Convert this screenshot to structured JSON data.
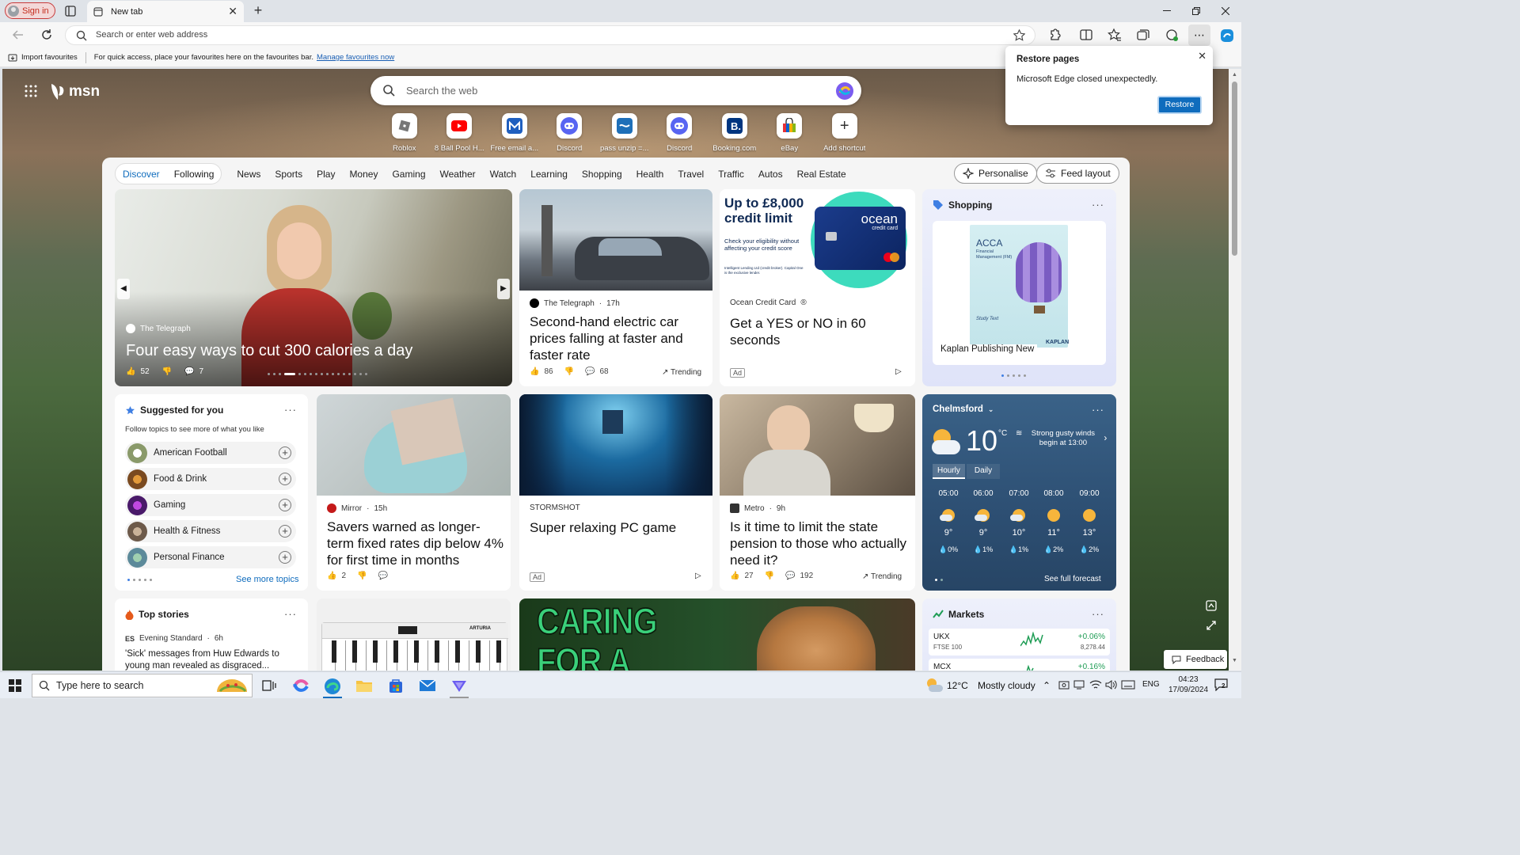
{
  "browser": {
    "signin_label": "Sign in",
    "tab_title": "New tab",
    "address_placeholder": "Search or enter web address",
    "favbar": {
      "import_label": "Import favourites",
      "hint_text": "For quick access, place your favourites here on the favourites bar.",
      "manage_link": "Manage favourites now"
    }
  },
  "restore_toast": {
    "title": "Restore pages",
    "message": "Microsoft Edge closed unexpectedly.",
    "button": "Restore"
  },
  "msn": {
    "logo_text": "msn",
    "search_placeholder": "Search the web",
    "shortcuts": [
      {
        "label": "Roblox",
        "icon": "roblox-icon",
        "color": "#555555"
      },
      {
        "label": "8 Ball Pool H...",
        "icon": "youtube-icon",
        "color": "#ff0000"
      },
      {
        "label": "Free email a...",
        "icon": "mail-m-icon",
        "color": "#1f5fbf"
      },
      {
        "label": "Discord",
        "icon": "discord-icon",
        "color": "#5865f2"
      },
      {
        "label": "pass unzip =...",
        "icon": "unzip-icon",
        "color": "#1e6fb8"
      },
      {
        "label": "Discord",
        "icon": "discord-icon",
        "color": "#5865f2"
      },
      {
        "label": "Booking.com",
        "icon": "booking-icon",
        "color": "#003580"
      },
      {
        "label": "eBay",
        "icon": "ebay-bag-icon",
        "color": "#e53238"
      },
      {
        "label": "Add shortcut",
        "icon": "plus-icon",
        "color": "#333333"
      }
    ],
    "feed_tabs": {
      "primary": [
        "Discover",
        "Following"
      ],
      "categories": [
        "News",
        "Sports",
        "Play",
        "Money",
        "Gaming",
        "Weather",
        "Watch",
        "Learning",
        "Shopping",
        "Health",
        "Travel",
        "Traffic",
        "Autos",
        "Real Estate"
      ]
    },
    "personalise_label": "Personalise",
    "feed_layout_label": "Feed layout",
    "hero": {
      "source": "The Telegraph",
      "headline": "Four easy ways to cut 300 calories a day",
      "likes": "52",
      "comments": "7"
    },
    "car_story": {
      "source": "The Telegraph",
      "age": "17h",
      "headline": "Second-hand electric car prices falling at faster and faster rate",
      "likes": "86",
      "comments": "68",
      "trending": "Trending"
    },
    "ocean_ad": {
      "banner_title": "Up to £8,000 credit limit",
      "banner_sub": "Check your eligibility without affecting your credit score",
      "fine_print": "Intelligent Lending Ltd (credit broker). Capital One is the exclusive lender.",
      "card_brand": "ocean",
      "card_sub": "credit card",
      "source": "Ocean Credit Card",
      "headline": "Get a YES or NO in 60 seconds",
      "ad_label": "Ad"
    },
    "shopping": {
      "title": "Shopping",
      "book_title": "ACCA",
      "book_sub": "Financial Management (FM)",
      "book_label": "Study Text",
      "book_brand": "KAPLAN",
      "caption": "Kaplan Publishing New"
    },
    "suggested": {
      "title": "Suggested for you",
      "subtitle": "Follow topics to see more of what you like",
      "topics": [
        "American Football",
        "Food & Drink",
        "Gaming",
        "Health & Fitness",
        "Personal Finance"
      ],
      "see_more": "See more topics"
    },
    "savers_story": {
      "source": "Mirror",
      "age": "15h",
      "headline": "Savers warned as longer-term fixed rates dip below 4% for first time in months",
      "likes": "2"
    },
    "game_ad": {
      "source": "STORMSHOT",
      "headline": "Super relaxing PC game",
      "ad_label": "Ad"
    },
    "pension_story": {
      "source": "Metro",
      "age": "9h",
      "headline": "Is it time to limit the state pension to those who actually need it?",
      "likes": "27",
      "comments": "192",
      "trending": "Trending"
    },
    "weather": {
      "location": "Chelmsford",
      "temp": "10",
      "unit": "°C",
      "alert": "Strong gusty winds begin at 13:00",
      "tabs": [
        "Hourly",
        "Daily"
      ],
      "hours": [
        {
          "time": "05:00",
          "temp": "9°",
          "precip": "0%",
          "icon": "cloud-sun-icon"
        },
        {
          "time": "06:00",
          "temp": "9°",
          "precip": "1%",
          "icon": "cloud-sun-icon"
        },
        {
          "time": "07:00",
          "temp": "10°",
          "precip": "1%",
          "icon": "cloud-sun-icon"
        },
        {
          "time": "08:00",
          "temp": "11°",
          "precip": "2%",
          "icon": "sun-cloud-icon"
        },
        {
          "time": "09:00",
          "temp": "13°",
          "precip": "2%",
          "icon": "sun-cloud-icon"
        }
      ],
      "see_full": "See full forecast"
    },
    "top_stories": {
      "title": "Top stories",
      "source": "Evening Standard",
      "age": "6h",
      "headline": "'Sick' messages from Huw Edwards to young man revealed as disgraced..."
    },
    "keyboard_brand": "ARTURIA",
    "cat_banner_text": "CARING FOR A BLIND",
    "markets": {
      "title": "Markets",
      "rows": [
        {
          "symbol": "UKX",
          "name": "FTSE 100",
          "change": "+0.06%",
          "value": "8,278.44"
        },
        {
          "symbol": "MCX",
          "change": "+0.16%"
        }
      ]
    },
    "feedback_label": "Feedback"
  },
  "taskbar": {
    "search_placeholder": "Type here to search",
    "weather_temp": "12°C",
    "weather_desc": "Mostly cloudy",
    "language": "ENG",
    "time": "04:23",
    "date": "17/09/2024",
    "notification_count": "2"
  }
}
